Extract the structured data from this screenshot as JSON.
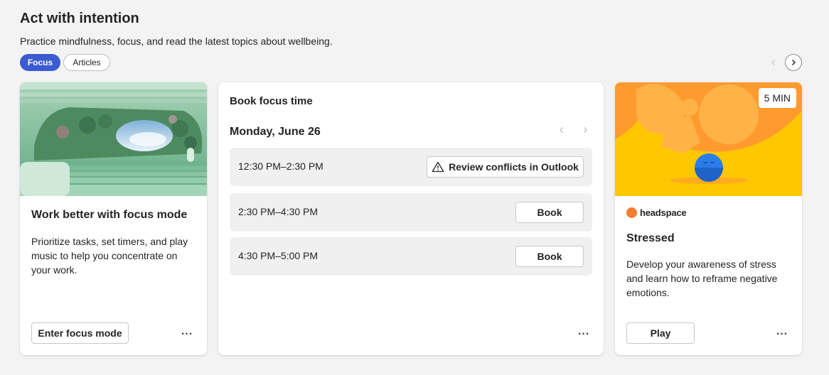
{
  "header": {
    "title": "Act with intention",
    "subtitle": "Practice mindfulness, focus, and read the latest topics about wellbeing."
  },
  "tabs": [
    {
      "label": "Focus",
      "active": true
    },
    {
      "label": "Articles",
      "active": false
    }
  ],
  "carousel": {
    "prev_icon": "chevron-left-icon",
    "next_icon": "chevron-right-icon"
  },
  "focus_mode_card": {
    "title": "Work better with focus mode",
    "description": "Prioritize tasks, set timers, and play music to help you concentrate on your work.",
    "button_label": "Enter focus mode",
    "more_label": "..."
  },
  "book_focus_card": {
    "title": "Book focus time",
    "date": "Monday, June 26",
    "slots": [
      {
        "time": "12:30 PM–2:30 PM",
        "action": "Review conflicts in Outlook",
        "warning_icon": "warning-icon"
      },
      {
        "time": "2:30 PM–4:30 PM",
        "action": "Book"
      },
      {
        "time": "4:30 PM–5:00 PM",
        "action": "Book"
      }
    ],
    "more_label": "..."
  },
  "headspace_card": {
    "duration_badge": "5 MIN",
    "brand": "headspace",
    "title": "Stressed",
    "description": "Develop your awareness of stress and learn how to reframe negative emotions.",
    "button_label": "Play",
    "more_label": "..."
  },
  "colors": {
    "accent": "#3a5bd1",
    "background": "#f3f3f3",
    "headspace_orange": "#f47d31",
    "headspace_yellow": "#ffc700"
  }
}
